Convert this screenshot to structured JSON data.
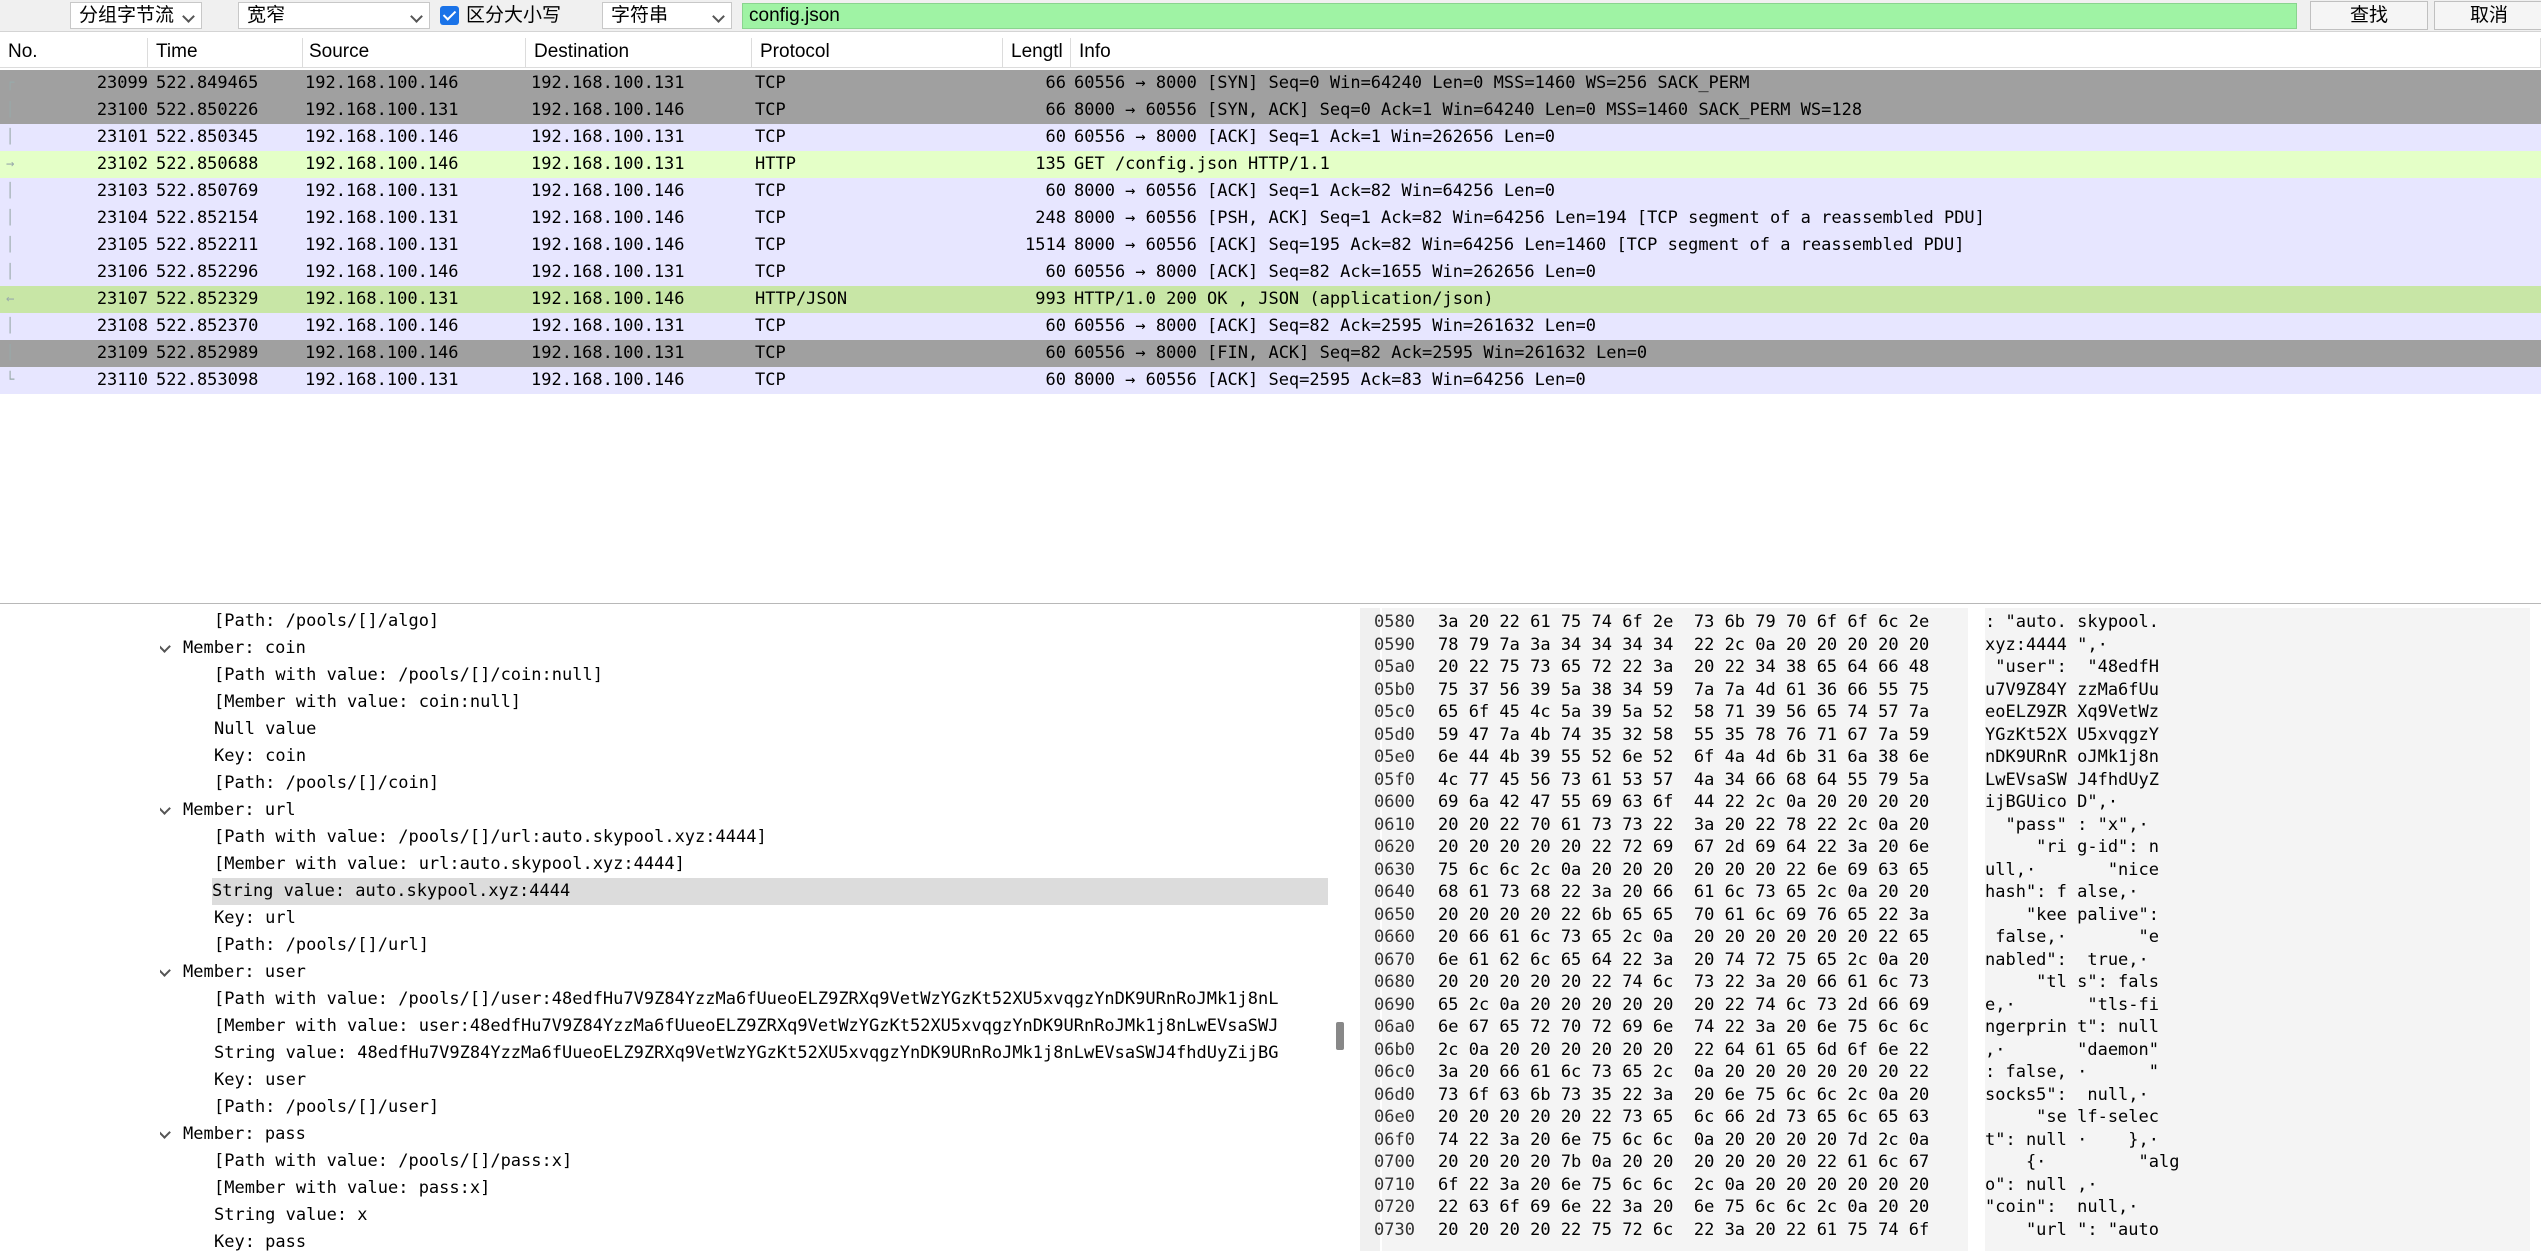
{
  "findbar": {
    "search_in": "分组字节流",
    "char_width": "宽窄",
    "case_sensitive_label": "区分大小写",
    "search_type": "字符串",
    "search_value": "config.json",
    "find_label": "查找",
    "cancel_label": "取消"
  },
  "packet_list": {
    "headers": [
      "No.",
      "Time",
      "Source",
      "Destination",
      "Protocol",
      "Lengtl",
      "Info"
    ],
    "colors": {
      "gray": "#a0a0a0",
      "tcp": "#e7e6ff",
      "http": "#e4ffc7",
      "http_selected": "#c8e6a6"
    },
    "rows": [
      {
        "no": "23099",
        "time": "522.849465",
        "src": "192.168.100.146",
        "dst": "192.168.100.131",
        "proto": "TCP",
        "len": "66",
        "info": "60556 → 8000 [SYN] Seq=0 Win=64240 Len=0 MSS=1460 WS=256 SACK_PERM",
        "color": "gray"
      },
      {
        "no": "23100",
        "time": "522.850226",
        "src": "192.168.100.131",
        "dst": "192.168.100.146",
        "proto": "TCP",
        "len": "66",
        "info": "8000 → 60556 [SYN, ACK] Seq=0 Ack=1 Win=64240 Len=0 MSS=1460 SACK_PERM WS=128",
        "color": "gray"
      },
      {
        "no": "23101",
        "time": "522.850345",
        "src": "192.168.100.146",
        "dst": "192.168.100.131",
        "proto": "TCP",
        "len": "60",
        "info": "60556 → 8000 [ACK] Seq=1 Ack=1 Win=262656 Len=0",
        "color": "tcp"
      },
      {
        "no": "23102",
        "time": "522.850688",
        "src": "192.168.100.146",
        "dst": "192.168.100.131",
        "proto": "HTTP",
        "len": "135",
        "info": "GET /config.json HTTP/1.1",
        "color": "http"
      },
      {
        "no": "23103",
        "time": "522.850769",
        "src": "192.168.100.131",
        "dst": "192.168.100.146",
        "proto": "TCP",
        "len": "60",
        "info": "8000 → 60556 [ACK] Seq=1 Ack=82 Win=64256 Len=0",
        "color": "tcp"
      },
      {
        "no": "23104",
        "time": "522.852154",
        "src": "192.168.100.131",
        "dst": "192.168.100.146",
        "proto": "TCP",
        "len": "248",
        "info": "8000 → 60556 [PSH, ACK] Seq=1 Ack=82 Win=64256 Len=194 [TCP segment of a reassembled PDU]",
        "color": "tcp"
      },
      {
        "no": "23105",
        "time": "522.852211",
        "src": "192.168.100.131",
        "dst": "192.168.100.146",
        "proto": "TCP",
        "len": "1514",
        "info": "8000 → 60556 [ACK] Seq=195 Ack=82 Win=64256 Len=1460 [TCP segment of a reassembled PDU]",
        "color": "tcp"
      },
      {
        "no": "23106",
        "time": "522.852296",
        "src": "192.168.100.146",
        "dst": "192.168.100.131",
        "proto": "TCP",
        "len": "60",
        "info": "60556 → 8000 [ACK] Seq=82 Ack=1655 Win=262656 Len=0",
        "color": "tcp"
      },
      {
        "no": "23107",
        "time": "522.852329",
        "src": "192.168.100.131",
        "dst": "192.168.100.146",
        "proto": "HTTP/JSON",
        "len": "993",
        "info": "HTTP/1.0 200 OK , JSON (application/json)",
        "color": "http_selected"
      },
      {
        "no": "23108",
        "time": "522.852370",
        "src": "192.168.100.146",
        "dst": "192.168.100.131",
        "proto": "TCP",
        "len": "60",
        "info": "60556 → 8000 [ACK] Seq=82 Ack=2595 Win=261632 Len=0",
        "color": "tcp"
      },
      {
        "no": "23109",
        "time": "522.852989",
        "src": "192.168.100.146",
        "dst": "192.168.100.131",
        "proto": "TCP",
        "len": "60",
        "info": "60556 → 8000 [FIN, ACK] Seq=82 Ack=2595 Win=261632 Len=0",
        "color": "gray"
      },
      {
        "no": "23110",
        "time": "522.853098",
        "src": "192.168.100.131",
        "dst": "192.168.100.146",
        "proto": "TCP",
        "len": "60",
        "info": "8000 → 60556 [ACK] Seq=2595 Ack=83 Win=64256 Len=0",
        "color": "tcp"
      }
    ]
  },
  "detail_tree": [
    {
      "text": "[Path: /pools/[]/algo]",
      "level": 2
    },
    {
      "text": "Member: coin",
      "level": 1,
      "expand": true
    },
    {
      "text": "[Path with value: /pools/[]/coin:null]",
      "level": 2
    },
    {
      "text": "[Member with value: coin:null]",
      "level": 2
    },
    {
      "text": "Null value",
      "level": 2
    },
    {
      "text": "Key: coin",
      "level": 2
    },
    {
      "text": "[Path: /pools/[]/coin]",
      "level": 2
    },
    {
      "text": "Member: url",
      "level": 1,
      "expand": true
    },
    {
      "text": "[Path with value: /pools/[]/url:auto.skypool.xyz:4444]",
      "level": 2
    },
    {
      "text": "[Member with value: url:auto.skypool.xyz:4444]",
      "level": 2
    },
    {
      "text": "String value: auto.skypool.xyz:4444",
      "level": 2,
      "selected": true
    },
    {
      "text": "Key: url",
      "level": 2
    },
    {
      "text": "[Path: /pools/[]/url]",
      "level": 2
    },
    {
      "text": "Member: user",
      "level": 1,
      "expand": true
    },
    {
      "text": "[Path with value: /pools/[]/user:48edfHu7V9Z84YzzMa6fUueoELZ9ZRXq9VetWzYGzKt52XU5xvqgzYnDK9URnRoJMk1j8nL",
      "level": 2
    },
    {
      "text": "[Member with value: user:48edfHu7V9Z84YzzMa6fUueoELZ9ZRXq9VetWzYGzKt52XU5xvqgzYnDK9URnRoJMk1j8nLwEVsaSWJ",
      "level": 2
    },
    {
      "text": "String value: 48edfHu7V9Z84YzzMa6fUueoELZ9ZRXq9VetWzYGzKt52XU5xvqgzYnDK9URnRoJMk1j8nLwEVsaSWJ4fhdUyZijBG",
      "level": 2
    },
    {
      "text": "Key: user",
      "level": 2
    },
    {
      "text": "[Path: /pools/[]/user]",
      "level": 2
    },
    {
      "text": "Member: pass",
      "level": 1,
      "expand": true
    },
    {
      "text": "[Path with value: /pools/[]/pass:x]",
      "level": 2
    },
    {
      "text": "[Member with value: pass:x]",
      "level": 2
    },
    {
      "text": "String value: x",
      "level": 2
    },
    {
      "text": "Key: pass",
      "level": 2
    }
  ],
  "hex_dump": [
    {
      "off": "0580",
      "bytes": "3a 20 22 61 75 74 6f 2e  73 6b 79 70 6f 6f 6c 2e",
      "ascii": ": \"auto. skypool."
    },
    {
      "off": "0590",
      "bytes": "78 79 7a 3a 34 34 34 34  22 2c 0a 20 20 20 20 20",
      "ascii": "xyz:4444 \",·     "
    },
    {
      "off": "05a0",
      "bytes": "20 22 75 73 65 72 22 3a  20 22 34 38 65 64 66 48",
      "ascii": " \"user\":  \"48edfH"
    },
    {
      "off": "05b0",
      "bytes": "75 37 56 39 5a 38 34 59  7a 7a 4d 61 36 66 55 75",
      "ascii": "u7V9Z84Y zzMa6fUu"
    },
    {
      "off": "05c0",
      "bytes": "65 6f 45 4c 5a 39 5a 52  58 71 39 56 65 74 57 7a",
      "ascii": "eoELZ9ZR Xq9VetWz"
    },
    {
      "off": "05d0",
      "bytes": "59 47 7a 4b 74 35 32 58  55 35 78 76 71 67 7a 59",
      "ascii": "YGzKt52X U5xvqgzY"
    },
    {
      "off": "05e0",
      "bytes": "6e 44 4b 39 55 52 6e 52  6f 4a 4d 6b 31 6a 38 6e",
      "ascii": "nDK9URnR oJMk1j8n"
    },
    {
      "off": "05f0",
      "bytes": "4c 77 45 56 73 61 53 57  4a 34 66 68 64 55 79 5a",
      "ascii": "LwEVsaSW J4fhdUyZ"
    },
    {
      "off": "0600",
      "bytes": "69 6a 42 47 55 69 63 6f  44 22 2c 0a 20 20 20 20",
      "ascii": "ijBGUico D\",·    "
    },
    {
      "off": "0610",
      "bytes": "20 20 22 70 61 73 73 22  3a 20 22 78 22 2c 0a 20",
      "ascii": "  \"pass\" : \"x\",· "
    },
    {
      "off": "0620",
      "bytes": "20 20 20 20 20 22 72 69  67 2d 69 64 22 3a 20 6e",
      "ascii": "     \"ri g-id\": n"
    },
    {
      "off": "0630",
      "bytes": "75 6c 6c 2c 0a 20 20 20  20 20 20 22 6e 69 63 65",
      "ascii": "ull,·       \"nice"
    },
    {
      "off": "0640",
      "bytes": "68 61 73 68 22 3a 20 66  61 6c 73 65 2c 0a 20 20",
      "ascii": "hash\": f alse,·  "
    },
    {
      "off": "0650",
      "bytes": "20 20 20 20 22 6b 65 65  70 61 6c 69 76 65 22 3a",
      "ascii": "    \"kee palive\":"
    },
    {
      "off": "0660",
      "bytes": "20 66 61 6c 73 65 2c 0a  20 20 20 20 20 20 22 65",
      "ascii": " false,·       \"e"
    },
    {
      "off": "0670",
      "bytes": "6e 61 62 6c 65 64 22 3a  20 74 72 75 65 2c 0a 20",
      "ascii": "nabled\":  true,· "
    },
    {
      "off": "0680",
      "bytes": "20 20 20 20 20 22 74 6c  73 22 3a 20 66 61 6c 73",
      "ascii": "     \"tl s\": fals"
    },
    {
      "off": "0690",
      "bytes": "65 2c 0a 20 20 20 20 20  20 22 74 6c 73 2d 66 69",
      "ascii": "e,·       \"tls-fi"
    },
    {
      "off": "06a0",
      "bytes": "6e 67 65 72 70 72 69 6e  74 22 3a 20 6e 75 6c 6c",
      "ascii": "ngerprin t\": null"
    },
    {
      "off": "06b0",
      "bytes": "2c 0a 20 20 20 20 20 20  22 64 61 65 6d 6f 6e 22",
      "ascii": ",·       \"daemon\""
    },
    {
      "off": "06c0",
      "bytes": "3a 20 66 61 6c 73 65 2c  0a 20 20 20 20 20 20 22",
      "ascii": ": false, ·      \""
    },
    {
      "off": "06d0",
      "bytes": "73 6f 63 6b 73 35 22 3a  20 6e 75 6c 6c 2c 0a 20",
      "ascii": "socks5\":  null,· "
    },
    {
      "off": "06e0",
      "bytes": "20 20 20 20 20 22 73 65  6c 66 2d 73 65 6c 65 63",
      "ascii": "     \"se lf-selec"
    },
    {
      "off": "06f0",
      "bytes": "74 22 3a 20 6e 75 6c 6c  0a 20 20 20 20 7d 2c 0a",
      "ascii": "t\": null ·    },·"
    },
    {
      "off": "0700",
      "bytes": "20 20 20 20 7b 0a 20 20  20 20 20 20 22 61 6c 67",
      "ascii": "    {·         \"alg"
    },
    {
      "off": "0710",
      "bytes": "6f 22 3a 20 6e 75 6c 6c  2c 0a 20 20 20 20 20 20",
      "ascii": "o\": null ,·      "
    },
    {
      "off": "0720",
      "bytes": "22 63 6f 69 6e 22 3a 20  6e 75 6c 6c 2c 0a 20 20",
      "ascii": "\"coin\":  null,·  "
    },
    {
      "off": "0730",
      "bytes": "20 20 20 20 22 75 72 6c  22 3a 20 22 61 75 74 6f",
      "ascii": "    \"url \": \"auto"
    }
  ]
}
